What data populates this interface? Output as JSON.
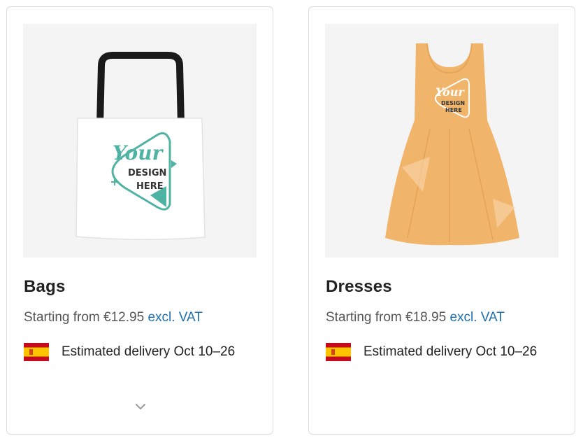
{
  "products": [
    {
      "title": "Bags",
      "price_text": "Starting from €12.95",
      "price_suffix": "excl. VAT",
      "delivery_text": "Estimated delivery Oct 10–26",
      "image_text": {
        "your": "Your",
        "design": "DESIGN",
        "here": "HERE"
      }
    },
    {
      "title": "Dresses",
      "price_text": "Starting from €18.95",
      "price_suffix": "excl. VAT",
      "delivery_text": "Estimated delivery Oct 10–26",
      "image_text": {
        "your": "Your",
        "design": "DESIGN",
        "here": "HERE"
      }
    }
  ],
  "icons": {
    "flag": "spain-flag-icon",
    "expand": "chevron-down-icon"
  },
  "colors": {
    "accent_link": "#1d6fb0",
    "logo_teal": "#4fb3a4",
    "dress_orange": "#f0b46a"
  }
}
